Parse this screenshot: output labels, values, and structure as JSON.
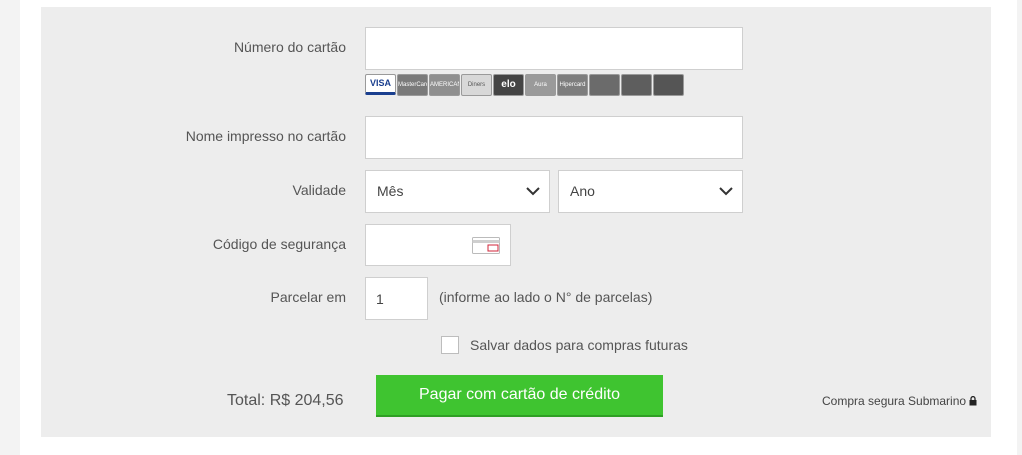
{
  "form": {
    "card_number_label": "Número do cartão",
    "card_number_value": "",
    "card_name_label": "Nome impresso no cartão",
    "card_name_value": "",
    "validity_label": "Validade",
    "month_select": "Mês",
    "year_select": "Ano",
    "security_code_label": "Código de segurança",
    "security_code_value": "",
    "installments_label": "Parcelar em",
    "installments_value": "1",
    "installments_hint": "(informe ao lado o N° de parcelas)",
    "save_data_label": "Salvar dados para compras futuras",
    "save_data_checked": false
  },
  "card_brands": [
    {
      "name": "visa-icon",
      "text": "VISA",
      "bg": "#ffffff",
      "fg": "#1a3f8f"
    },
    {
      "name": "mastercard-icon",
      "text": "MasterCard",
      "bg": "#7a7a7a",
      "fg": "#ffffff"
    },
    {
      "name": "amex-icon",
      "text": "AMERICAN EXPRESS",
      "bg": "#8f8f8f",
      "fg": "#ffffff"
    },
    {
      "name": "diners-icon",
      "text": "Diners Club",
      "bg": "#d8d8d8",
      "fg": "#555555"
    },
    {
      "name": "elo-icon",
      "text": "elo",
      "bg": "#444444",
      "fg": "#ffffff"
    },
    {
      "name": "aura-icon",
      "text": "Aura",
      "bg": "#9a9a9a",
      "fg": "#ffffff"
    },
    {
      "name": "hipercard-icon",
      "text": "Hipercard",
      "bg": "#7d7d7d",
      "fg": "#ffffff"
    },
    {
      "name": "bank-card-icon-1",
      "text": "",
      "bg": "#6b6b6b",
      "fg": "#ffffff"
    },
    {
      "name": "bank-card-icon-2",
      "text": "",
      "bg": "#5e5e5e",
      "fg": "#ffffff"
    },
    {
      "name": "bank-card-icon-3",
      "text": "",
      "bg": "#555555",
      "fg": "#ffffff"
    }
  ],
  "footer": {
    "total_text": "Total: R$ 204,56",
    "pay_button_label": "Pagar com cartão de crédito",
    "secure_text": "Compra segura Submarino"
  },
  "colors": {
    "accent_green": "#3fc430",
    "panel_bg": "#ededed"
  }
}
